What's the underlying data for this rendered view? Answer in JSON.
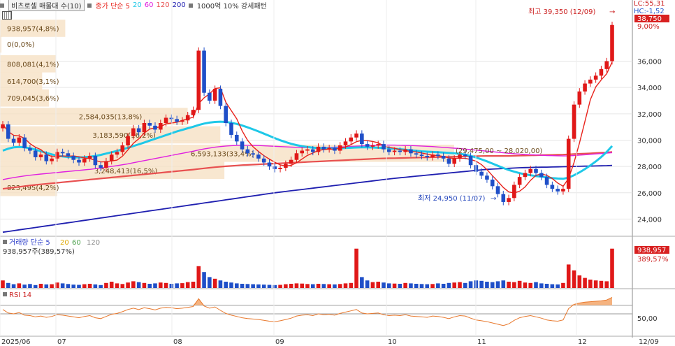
{
  "header": {
    "stock_label": "비츠로셀 매물대 수(10)",
    "price_series": [
      "종가 단순 5",
      "20",
      "60",
      "120",
      "200"
    ],
    "price_series_colors": [
      "#e8231c",
      "#1ec8e8",
      "#e020e0",
      "#e85050",
      "#1f1fb0"
    ],
    "flag_label": "1000억 10% 강세패턴"
  },
  "volume_header": {
    "label": "거래량 단순 5",
    "ma_labels": [
      "20",
      "60",
      "120"
    ],
    "value_text": "938,957주(389,57%)"
  },
  "rsi_header": {
    "label": "RSI 14"
  },
  "right_axis": {
    "lc": "LC:55,31",
    "hc": "HC:-1,52",
    "current_price": "38,750",
    "current_pct": "9,00%",
    "price_ticks": [
      "36,000",
      "34,000",
      "32,000",
      "30,000",
      "28,000",
      "26,000",
      "24,000"
    ],
    "volume_badge": "938,957",
    "volume_pct": "389,57%",
    "rsi_tick": "50,00",
    "date_label": "12/09"
  },
  "x_axis": {
    "labels": [
      "2025/06",
      "07",
      "08",
      "09",
      "10",
      "11",
      "12"
    ]
  },
  "annotations": {
    "high": "최고 39,350 (12/09)",
    "low": "최저 24,950 (11/07)"
  },
  "volume_profile": [
    {
      "price": 38500,
      "label": "938,957(4,8%)"
    },
    {
      "price": 37300,
      "label": "0(0,0%)"
    },
    {
      "price": 35800,
      "label": "808,081(4,1%)"
    },
    {
      "price": 34500,
      "label": "614,700(3,1%)"
    },
    {
      "price": 33200,
      "label": "709,045(3,6%)"
    },
    {
      "price": 31800,
      "label": "2,584,035(13,8%)"
    },
    {
      "price": 30400,
      "label": "3,183,590(16,2%)"
    },
    {
      "price": 29000,
      "label": "6,593,133(33,4%)"
    },
    {
      "price": 27700,
      "label": "3,248,413(16,5%)"
    },
    {
      "price": 26400,
      "label": "823,495(4,2%)"
    }
  ],
  "band_label": "(29,475,00 ~ 28,020,00)",
  "chart_data": {
    "type": "candlestick",
    "title": "비츠로셀",
    "ylim": [
      22800,
      39800
    ],
    "yticks": [
      24000,
      26000,
      28000,
      30000,
      32000,
      34000,
      36000
    ],
    "x_labels": [
      "2025/06",
      "07",
      "08",
      "09",
      "10",
      "11",
      "12"
    ],
    "close": [
      31200,
      30100,
      29800,
      30200,
      29400,
      29200,
      28700,
      28900,
      28400,
      28600,
      29100,
      29000,
      28800,
      28500,
      28300,
      28600,
      28800,
      28100,
      27900,
      28400,
      28900,
      29100,
      29600,
      30300,
      30900,
      30600,
      31300,
      31100,
      30800,
      31300,
      31700,
      31600,
      31400,
      31500,
      31900,
      32300,
      36800,
      33600,
      33000,
      33900,
      32600,
      31300,
      30400,
      29900,
      29300,
      29000,
      28900,
      28600,
      28300,
      28000,
      27800,
      27900,
      28200,
      28500,
      29000,
      29200,
      29300,
      29100,
      29500,
      29300,
      29400,
      29200,
      29600,
      29900,
      30200,
      30500,
      29700,
      29500,
      29600,
      29700,
      29300,
      29100,
      29200,
      29100,
      29300,
      29000,
      28900,
      28800,
      28700,
      28900,
      28800,
      28600,
      28200,
      28600,
      28900,
      28800,
      28100,
      27600,
      27300,
      27000,
      26500,
      25900,
      25300,
      25600,
      26600,
      27200,
      27500,
      27800,
      27500,
      27200,
      26600,
      26300,
      26100,
      26300,
      30100,
      32700,
      33700,
      34300,
      34600,
      34900,
      35400,
      36000,
      38750
    ],
    "ma20": [
      29200,
      29350,
      29450,
      29480,
      29450,
      29380,
      29280,
      29150,
      29030,
      28920,
      28820,
      28760,
      28720,
      28700,
      28680,
      28700,
      28740,
      28800,
      28880,
      28980,
      29080,
      29180,
      29300,
      29420,
      29550,
      29680,
      29820,
      29960,
      30100,
      30240,
      30380,
      30520,
      30660,
      30780,
      30900,
      31020,
      31150,
      31260,
      31330,
      31380,
      31400,
      31380,
      31320,
      31230,
      31110,
      30970,
      30820,
      30660,
      30490,
      30320,
      30150,
      29990,
      29850,
      29720,
      29620,
      29540,
      29480,
      29430,
      29400,
      29380,
      29370,
      29370,
      29380,
      29400,
      29420,
      29440,
      29450,
      29450,
      29440,
      29420,
      29400,
      29380,
      29350,
      29310,
      29270,
      29230,
      29190,
      29150,
      29120,
      29100,
      29080,
      29060,
      29030,
      29000,
      28960,
      28900,
      28800,
      28680,
      28540,
      28390,
      28220,
      28050,
      27880,
      27730,
      27600,
      27490,
      27400,
      27330,
      27270,
      27220,
      27170,
      27120,
      27080,
      27060,
      27150,
      27330,
      27550,
      27800,
      28080,
      28380,
      28720,
      29100,
      29550
    ],
    "ma60": [
      27000,
      27080,
      27150,
      27220,
      27280,
      27330,
      27380,
      27420,
      27460,
      27500,
      27540,
      27580,
      27620,
      27660,
      27700,
      27740,
      27780,
      27830,
      27880,
      27940,
      28000,
      28060,
      28130,
      28200,
      28280,
      28360,
      28440,
      28520,
      28600,
      28680,
      28760,
      28840,
      28920,
      29000,
      29080,
      29160,
      29250,
      29330,
      29400,
      29460,
      29510,
      29550,
      29580,
      29600,
      29610,
      29610,
      29600,
      29590,
      29570,
      29550,
      29530,
      29510,
      29490,
      29470,
      29450,
      29440,
      29430,
      29430,
      29430,
      29440,
      29450,
      29460,
      29480,
      29500,
      29520,
      29540,
      29560,
      29580,
      29600,
      29610,
      29620,
      29620,
      29620,
      29610,
      29600,
      29590,
      29570,
      29550,
      29530,
      29510,
      29480,
      29450,
      29420,
      29390,
      29360,
      29320,
      29280,
      29240,
      29200,
      29160,
      29120,
      29080,
      29040,
      29000,
      28970,
      28940,
      28910,
      28890,
      28870,
      28850,
      28830,
      28820,
      28810,
      28800,
      28810,
      28830,
      28860,
      28890,
      28920,
      28950,
      28980,
      29010,
      29050
    ],
    "ma120": [
      26300,
      26350,
      26400,
      26450,
      26500,
      26550,
      26600,
      26640,
      26680,
      26720,
      26760,
      26800,
      26840,
      26880,
      26920,
      26960,
      27000,
      27040,
      27080,
      27120,
      27160,
      27200,
      27240,
      27280,
      27320,
      27360,
      27400,
      27440,
      27480,
      27520,
      27560,
      27600,
      27640,
      27680,
      27720,
      27760,
      27810,
      27860,
      27900,
      27940,
      27980,
      28010,
      28040,
      28070,
      28100,
      28120,
      28140,
      28160,
      28180,
      28200,
      28220,
      28240,
      28260,
      28280,
      28300,
      28320,
      28340,
      28360,
      28380,
      28400,
      28420,
      28440,
      28460,
      28480,
      28500,
      28520,
      28540,
      28560,
      28580,
      28600,
      28610,
      28620,
      28630,
      28640,
      28650,
      28660,
      28670,
      28680,
      28690,
      28700,
      28710,
      28720,
      28730,
      28740,
      28750,
      28760,
      28770,
      28780,
      28790,
      28800,
      28800,
      28800,
      28800,
      28800,
      28810,
      28820,
      28830,
      28840,
      28850,
      28860,
      28870,
      28880,
      28890,
      28900,
      28920,
      28940,
      28960,
      28980,
      29000,
      29020,
      29040,
      29060,
      29100
    ],
    "ma200": [
      23000,
      23060,
      23120,
      23180,
      23240,
      23300,
      23360,
      23420,
      23480,
      23540,
      23600,
      23660,
      23720,
      23780,
      23840,
      23900,
      23960,
      24020,
      24080,
      24140,
      24200,
      24260,
      24320,
      24380,
      24440,
      24500,
      24560,
      24620,
      24680,
      24740,
      24800,
      24860,
      24920,
      24980,
      25040,
      25100,
      25160,
      25220,
      25280,
      25340,
      25400,
      25460,
      25520,
      25580,
      25640,
      25700,
      25760,
      25820,
      25880,
      25940,
      26000,
      26050,
      26100,
      26150,
      26200,
      26250,
      26300,
      26350,
      26400,
      26450,
      26500,
      26550,
      26600,
      26650,
      26700,
      26750,
      26800,
      26850,
      26900,
      26950,
      27000,
      27050,
      27100,
      27140,
      27180,
      27220,
      27260,
      27300,
      27340,
      27380,
      27420,
      27460,
      27500,
      27540,
      27580,
      27620,
      27660,
      27700,
      27740,
      27780,
      27800,
      27820,
      27840,
      27860,
      27880,
      27900,
      27910,
      27920,
      27930,
      27940,
      27950,
      27960,
      27970,
      27980,
      27990,
      28000,
      28010,
      28020,
      28030,
      28040,
      28050,
      28060,
      28080
    ],
    "volume": [
      180,
      120,
      90,
      110,
      80,
      95,
      70,
      100,
      85,
      90,
      130,
      110,
      95,
      80,
      75,
      90,
      100,
      85,
      70,
      120,
      150,
      110,
      95,
      130,
      160,
      140,
      120,
      100,
      110,
      130,
      120,
      100,
      110,
      115,
      140,
      150,
      520,
      380,
      260,
      220,
      180,
      150,
      130,
      110,
      100,
      95,
      90,
      85,
      80,
      75,
      70,
      75,
      90,
      100,
      110,
      105,
      95,
      90,
      100,
      95,
      90,
      85,
      95,
      110,
      120,
      938,
      260,
      180,
      140,
      150,
      130,
      110,
      105,
      100,
      120,
      110,
      100,
      95,
      90,
      95,
      110,
      100,
      120,
      130,
      140,
      120,
      160,
      180,
      170,
      150,
      140,
      160,
      180,
      150,
      140,
      170,
      130,
      120,
      140,
      110,
      100,
      90,
      85,
      120,
      560,
      420,
      300,
      240,
      200,
      180,
      170,
      160,
      938
    ],
    "volume_ylim": [
      0,
      1000
    ],
    "rsi": [
      60,
      52,
      50,
      53,
      47,
      46,
      43,
      45,
      42,
      44,
      48,
      47,
      45,
      43,
      41,
      44,
      46,
      41,
      39,
      44,
      49,
      51,
      55,
      60,
      63,
      60,
      64,
      62,
      59,
      63,
      65,
      64,
      62,
      63,
      65,
      67,
      85,
      68,
      63,
      66,
      58,
      51,
      47,
      44,
      41,
      39,
      38,
      37,
      35,
      33,
      32,
      34,
      37,
      40,
      45,
      47,
      48,
      46,
      50,
      48,
      49,
      47,
      51,
      54,
      57,
      60,
      52,
      50,
      51,
      52,
      48,
      46,
      47,
      46,
      48,
      45,
      44,
      43,
      42,
      45,
      44,
      42,
      39,
      43,
      46,
      45,
      40,
      36,
      34,
      32,
      29,
      26,
      23,
      27,
      35,
      41,
      44,
      46,
      43,
      40,
      36,
      34,
      33,
      36,
      62,
      72,
      75,
      77,
      78,
      79,
      80,
      82,
      88
    ],
    "rsi_ylim": [
      0,
      100
    ],
    "rsi_reference": [
      70,
      50
    ]
  }
}
